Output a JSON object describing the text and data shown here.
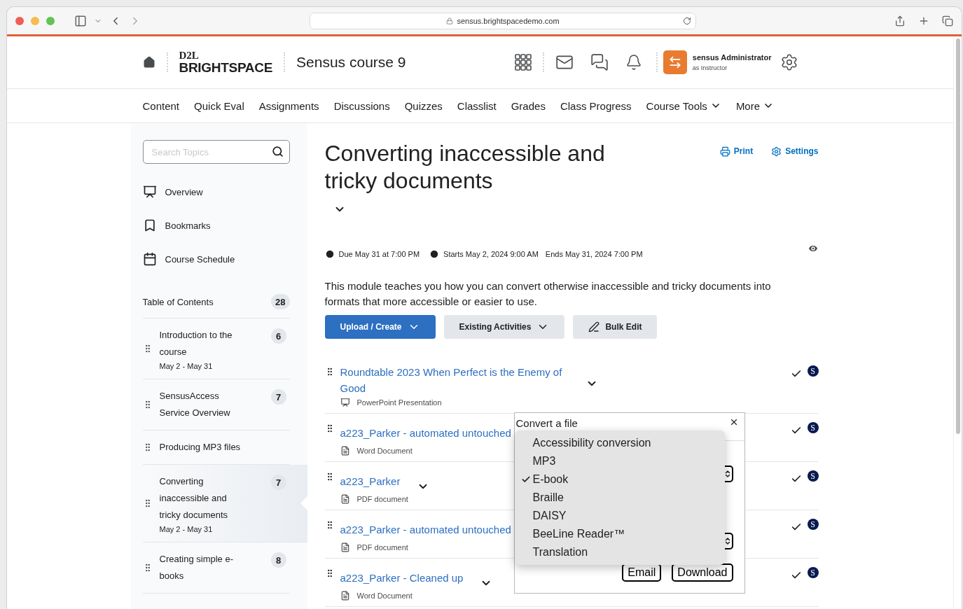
{
  "browser": {
    "address": "sensus.brightspacedemo.com"
  },
  "header": {
    "logo_top": "D2L",
    "logo_bottom": "BRIGHTSPACE",
    "course": "Sensus course 9",
    "user_name": "sensus Administrator",
    "user_role": "as Instructor"
  },
  "nav": [
    {
      "label": "Content",
      "dropdown": false
    },
    {
      "label": "Quick Eval",
      "dropdown": false
    },
    {
      "label": "Assignments",
      "dropdown": false
    },
    {
      "label": "Discussions",
      "dropdown": false
    },
    {
      "label": "Quizzes",
      "dropdown": false
    },
    {
      "label": "Classlist",
      "dropdown": false
    },
    {
      "label": "Grades",
      "dropdown": false
    },
    {
      "label": "Class Progress",
      "dropdown": false
    },
    {
      "label": "Course Tools",
      "dropdown": true
    },
    {
      "label": "More",
      "dropdown": true
    }
  ],
  "sidebar": {
    "search": {
      "placeholder": "Search Topics"
    },
    "links": [
      {
        "kind": "overview",
        "label": "Overview"
      },
      {
        "kind": "bookmarks",
        "label": "Bookmarks"
      },
      {
        "kind": "schedule",
        "label": "Course Schedule"
      }
    ],
    "toc": {
      "label": "Table of Contents",
      "count": "28"
    },
    "modules": [
      {
        "title": "Introduction to the course",
        "count": "6",
        "dates": "May 2 - May 31",
        "selected": false
      },
      {
        "title": "SensusAccess Service Overview",
        "count": "7",
        "selected": false
      },
      {
        "title": "Producing MP3 files",
        "selected": false
      },
      {
        "title": "Converting inaccessible and tricky documents",
        "count": "7",
        "dates": "May 2 - May 31",
        "selected": true
      },
      {
        "title": "Creating simple e-books",
        "count": "8",
        "selected": false
      }
    ]
  },
  "module": {
    "title": "Converting inaccessible and tricky documents",
    "actions": [
      "Print",
      "Settings"
    ],
    "due": "Due May 31 at 7:00 PM",
    "starts": "Starts May 2, 2024 9:00 AM",
    "ends": "Ends May 31, 2024 7:00 PM",
    "description": "This module teaches you how you can convert otherwise inaccessible and tricky documents into formats that more accessible or easier to use.",
    "buttons": [
      {
        "label": "Upload / Create",
        "kind": "primary"
      },
      {
        "label": "Existing Activities",
        "kind": "dropdown"
      },
      {
        "label": "Bulk Edit",
        "kind": "edit"
      }
    ],
    "items": [
      {
        "title": "Roundtable 2023 When Perfect is the Enemy of Good",
        "type": "PowerPoint Presentation",
        "kind": "presentation",
        "badge": "S"
      },
      {
        "title": "a223_Parker - automated untouched",
        "type": "Word Document",
        "kind": "document",
        "badge": "S"
      },
      {
        "title": "a223_Parker",
        "type": "PDF document",
        "kind": "document",
        "badge": "S"
      },
      {
        "title": "a223_Parker - automated untouched",
        "type": "PDF document",
        "kind": "document",
        "badge": "S"
      },
      {
        "title": "a223_Parker - Cleaned up",
        "type": "Word Document",
        "kind": "document",
        "badge": "S"
      }
    ]
  },
  "convert_dialog": {
    "title": "Convert a file",
    "buttons": [
      "Email",
      "Download"
    ],
    "options": [
      {
        "label": "Accessibility conversion",
        "selected": false
      },
      {
        "label": "MP3",
        "selected": false
      },
      {
        "label": "E-book",
        "selected": true
      },
      {
        "label": "Braille",
        "selected": false
      },
      {
        "label": "DAISY",
        "selected": false
      },
      {
        "label": "BeeLine Reader™",
        "selected": false
      },
      {
        "label": "Translation",
        "selected": false
      }
    ]
  }
}
